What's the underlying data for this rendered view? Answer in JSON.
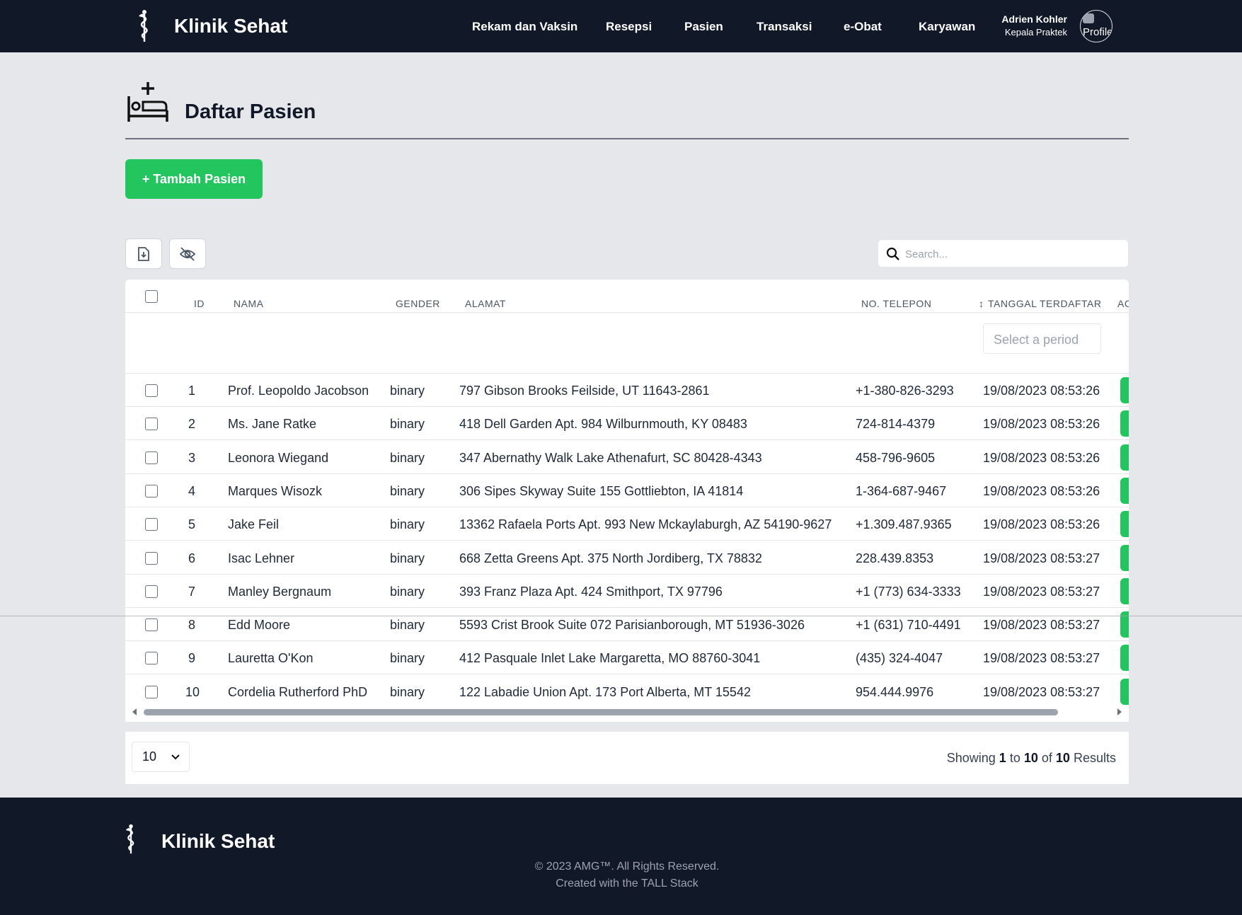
{
  "app": {
    "brand": "Klinik Sehat",
    "logo_icon": "caduceus-icon"
  },
  "nav": {
    "links": [
      "Rekam dan Vaksin",
      "Resepsi",
      "Pasien",
      "Transaksi",
      "e-Obat",
      "Karyawan"
    ],
    "user_name": "Adrien Kohler",
    "user_role": "Kepala Praktek",
    "avatar_alt": "Profile"
  },
  "page": {
    "title": "Daftar Pasien",
    "icon": "hospital-bed-icon",
    "add_button": "+ Tambah Pasien"
  },
  "toolbar": {
    "export_icon": "file-export-icon",
    "toggle_columns_icon": "eye-off-icon",
    "search_placeholder": "Search..."
  },
  "table": {
    "headers": {
      "id": "ID",
      "nama": "NAMA",
      "gender": "GENDER",
      "alamat": "ALAMAT",
      "telepon": "NO. TELEPON",
      "tanggal": "TANGGAL TERDAFTAR",
      "sort_icon": "↕",
      "aksi": "AC"
    },
    "period_placeholder": "Select a period",
    "rows": [
      {
        "id": "1",
        "nama": "Prof. Leopoldo Jacobson",
        "gender": "binary",
        "alamat": "797 Gibson Brooks Feilside, UT 11643-2861",
        "telepon": "+1-380-826-3293",
        "tanggal": "19/08/2023 08:53:26"
      },
      {
        "id": "2",
        "nama": "Ms. Jane Ratke",
        "gender": "binary",
        "alamat": "418 Dell Garden Apt. 984 Wilburnmouth, KY 08483",
        "telepon": "724-814-4379",
        "tanggal": "19/08/2023 08:53:26"
      },
      {
        "id": "3",
        "nama": "Leonora Wiegand",
        "gender": "binary",
        "alamat": "347 Abernathy Walk Lake Athenafurt, SC 80428-4343",
        "telepon": "458-796-9605",
        "tanggal": "19/08/2023 08:53:26"
      },
      {
        "id": "4",
        "nama": "Marques Wisozk",
        "gender": "binary",
        "alamat": "306 Sipes Skyway Suite 155 Gottliebton, IA 41814",
        "telepon": "1-364-687-9467",
        "tanggal": "19/08/2023 08:53:26"
      },
      {
        "id": "5",
        "nama": "Jake Feil",
        "gender": "binary",
        "alamat": "13362 Rafaela Ports Apt. 993 New Mckaylaburgh, AZ 54190-9627",
        "telepon": "+1.309.487.9365",
        "tanggal": "19/08/2023 08:53:26"
      },
      {
        "id": "6",
        "nama": "Isac Lehner",
        "gender": "binary",
        "alamat": "668 Zetta Greens Apt. 375 North Jordiberg, TX 78832",
        "telepon": "228.439.8353",
        "tanggal": "19/08/2023 08:53:27"
      },
      {
        "id": "7",
        "nama": "Manley Bergnaum",
        "gender": "binary",
        "alamat": "393 Franz Plaza Apt. 424 Smithport, TX 97796",
        "telepon": "+1 (773) 634-3333",
        "tanggal": "19/08/2023 08:53:27"
      },
      {
        "id": "8",
        "nama": "Edd Moore",
        "gender": "binary",
        "alamat": "5593 Crist Brook Suite 072 Parisianborough, MT 51936-3026",
        "telepon": "+1 (631) 710-4491",
        "tanggal": "19/08/2023 08:53:27"
      },
      {
        "id": "9",
        "nama": "Lauretta O'Kon",
        "gender": "binary",
        "alamat": "412 Pasquale Inlet Lake Margaretta, MO 88760-3041",
        "telepon": "(435) 324-4047",
        "tanggal": "19/08/2023 08:53:27"
      },
      {
        "id": "10",
        "nama": "Cordelia Rutherford PhD",
        "gender": "binary",
        "alamat": "122 Labadie Union Apt. 173 Port Alberta, MT 15542",
        "telepon": "954.444.9976",
        "tanggal": "19/08/2023 08:53:27"
      }
    ]
  },
  "pagination": {
    "per_page": "10",
    "showing_prefix": "Showing",
    "from": "1",
    "to_word": "to",
    "to": "10",
    "of_word": "of",
    "total": "10",
    "results_word": "Results"
  },
  "footer": {
    "brand": "Klinik Sehat",
    "copyright": "© 2023 AMG™. All Rights Reserved.",
    "credit": "Created with the TALL Stack"
  },
  "colors": {
    "navbar": "#111827",
    "accent_green": "#22c55e",
    "page_bg": "#e5e7eb"
  }
}
